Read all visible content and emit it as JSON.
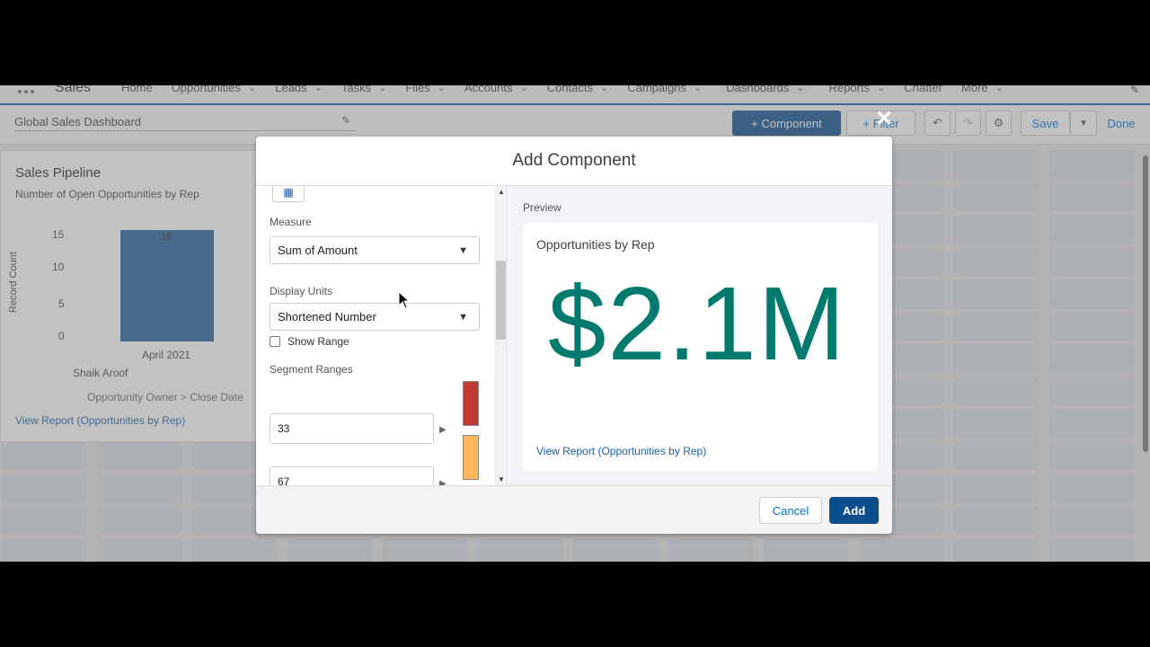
{
  "nav": {
    "app_name": "Sales",
    "items": [
      {
        "label": "Home",
        "chevron": false
      },
      {
        "label": "Opportunities",
        "chevron": true
      },
      {
        "label": "Leads",
        "chevron": true
      },
      {
        "label": "Tasks",
        "chevron": true
      },
      {
        "label": "Files",
        "chevron": true
      },
      {
        "label": "Accounts",
        "chevron": true
      },
      {
        "label": "Contacts",
        "chevron": true
      },
      {
        "label": "Campaigns",
        "chevron": true
      },
      {
        "label": "Dashboards",
        "chevron": true
      },
      {
        "label": "Reports",
        "chevron": true
      },
      {
        "label": "Chatter",
        "chevron": false
      },
      {
        "label": "More",
        "chevron": true
      }
    ]
  },
  "toolbar": {
    "dashboard_title": "Global Sales Dashboard",
    "component_label": "+ Component",
    "filter_label": "+ Filter",
    "save_label": "Save",
    "done_label": "Done"
  },
  "bg_card": {
    "title": "Sales Pipeline",
    "subtitle": "Number of Open Opportunities by Rep",
    "ylabel": "Record Count",
    "yticks": [
      "15",
      "10",
      "5",
      "0"
    ],
    "bar_value": "15",
    "category": "April 2021",
    "owner": "Shaik Aroof",
    "axis_path": "Opportunity Owner  >  Close Date",
    "link": "View Report (Opportunities by Rep)"
  },
  "modal": {
    "title": "Add Component",
    "measure_label": "Measure",
    "measure_value": "Sum of Amount",
    "units_label": "Display Units",
    "units_value": "Shortened Number",
    "show_range_label": "Show Range",
    "segment_label": "Segment Ranges",
    "range1": "33",
    "range2": "67",
    "preview_label": "Preview",
    "preview_title": "Opportunities by Rep",
    "preview_metric": "$2.1M",
    "preview_link": "View Report (Opportunities by Rep)",
    "cancel_label": "Cancel",
    "add_label": "Add"
  },
  "colors": {
    "brand": "#0c4d8c",
    "metric": "#007a6e",
    "segment_low": "#c23934",
    "segment_mid": "#ffb75d"
  }
}
